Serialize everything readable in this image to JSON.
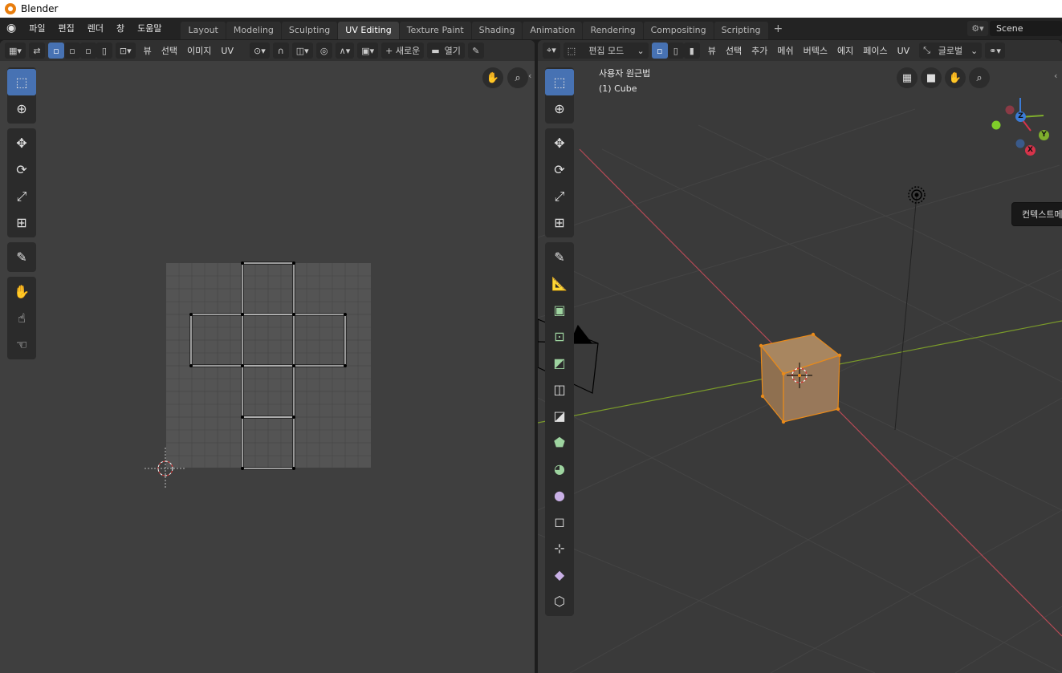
{
  "window": {
    "title": "Blender"
  },
  "menubar": {
    "items": [
      "파일",
      "편집",
      "렌더",
      "창",
      "도움말"
    ]
  },
  "workspaces": {
    "tabs": [
      "Layout",
      "Modeling",
      "Sculpting",
      "UV Editing",
      "Texture Paint",
      "Shading",
      "Animation",
      "Rendering",
      "Compositing",
      "Scripting"
    ],
    "active": "UV Editing",
    "add": "+"
  },
  "scene": {
    "name": "Scene"
  },
  "uv_editor": {
    "menus": [
      "뷰",
      "선택",
      "이미지",
      "UV"
    ],
    "new_label": "+ 새로운",
    "open_label": "열기"
  },
  "viewport": {
    "mode_label": "편집 모드",
    "menus": [
      "뷰",
      "선택",
      "추가",
      "메쉬",
      "버텍스",
      "에지",
      "페이스",
      "UV"
    ],
    "transform_orientation": "글로벌",
    "view_label": "사용자 원근법",
    "object_label": "(1) Cube",
    "tooltip": "컨텍스트메뉴",
    "gizmo": {
      "z": "Z",
      "y": "Y",
      "x": "X"
    }
  },
  "colors": {
    "accent": "#4772b3",
    "selection": "#e88a1a",
    "x_axis": "#b54a55",
    "y_axis": "#7a9a2a"
  }
}
